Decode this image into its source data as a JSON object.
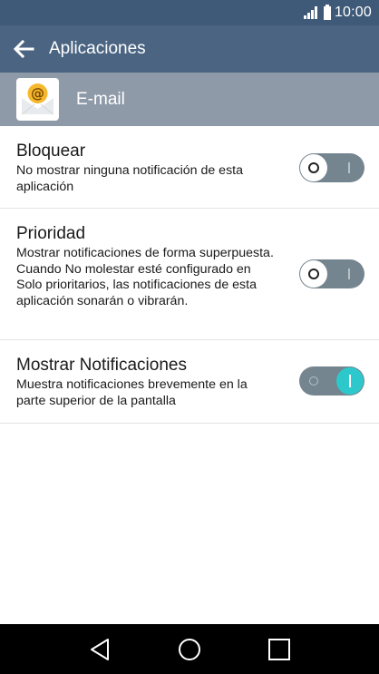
{
  "status_bar": {
    "time": "10:00"
  },
  "app_bar": {
    "title": "Aplicaciones",
    "back_icon": "arrow-left-icon"
  },
  "app_header": {
    "app_name": "E-mail",
    "app_icon": "email-at-icon"
  },
  "settings": [
    {
      "title": "Bloquear",
      "description": "No mostrar ninguna notificación de esta aplicación",
      "enabled": false
    },
    {
      "title": "Prioridad",
      "description": "Mostrar notificaciones de forma superpuesta. Cuando No molestar esté configurado en Solo prioritarios, las notificaciones de esta aplicación sonarán o vibrarán.",
      "enabled": false
    },
    {
      "title": "Mostrar Notificaciones",
      "description": "Muestra notificaciones brevemente en la parte superior de la pantalla",
      "enabled": true
    }
  ],
  "nav_bar": {
    "back_icon": "nav-back-icon",
    "home_icon": "nav-home-icon",
    "recents_icon": "nav-recents-icon"
  },
  "colors": {
    "status_bar": "#3f5a78",
    "app_bar": "#4a6482",
    "app_header": "#8f9aa8",
    "toggle_track": "#75858f",
    "toggle_on_accent": "#2dc8cc"
  }
}
